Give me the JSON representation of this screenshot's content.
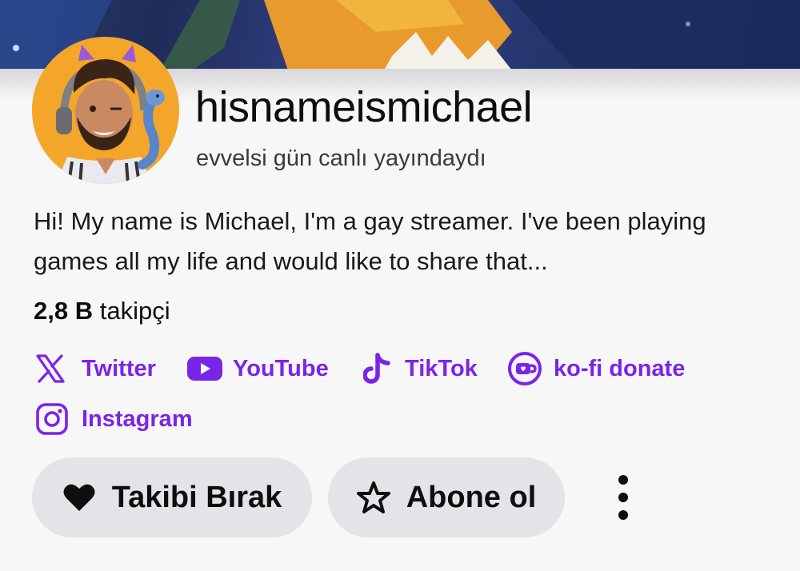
{
  "profile": {
    "channel_name": "hisnameismichael",
    "last_live": "evvelsi gün canlı yayındaydı",
    "bio": "Hi! My name is Michael, I'm a gay streamer. I've been playing games all my life and would like to share that...",
    "followers_count": "2,8 B",
    "followers_label": "takipçi"
  },
  "links": [
    {
      "label": "Twitter",
      "icon": "x-icon"
    },
    {
      "label": "YouTube",
      "icon": "youtube-icon"
    },
    {
      "label": "TikTok",
      "icon": "tiktok-icon"
    },
    {
      "label": "ko-fi donate",
      "icon": "kofi-icon"
    },
    {
      "label": "Instagram",
      "icon": "instagram-icon"
    }
  ],
  "actions": {
    "unfollow_label": "Takibi Bırak",
    "subscribe_label": "Abone ol"
  },
  "colors": {
    "accent": "#7a24e8",
    "button_bg": "#e4e4e8",
    "avatar_bg": "#f3a629"
  }
}
